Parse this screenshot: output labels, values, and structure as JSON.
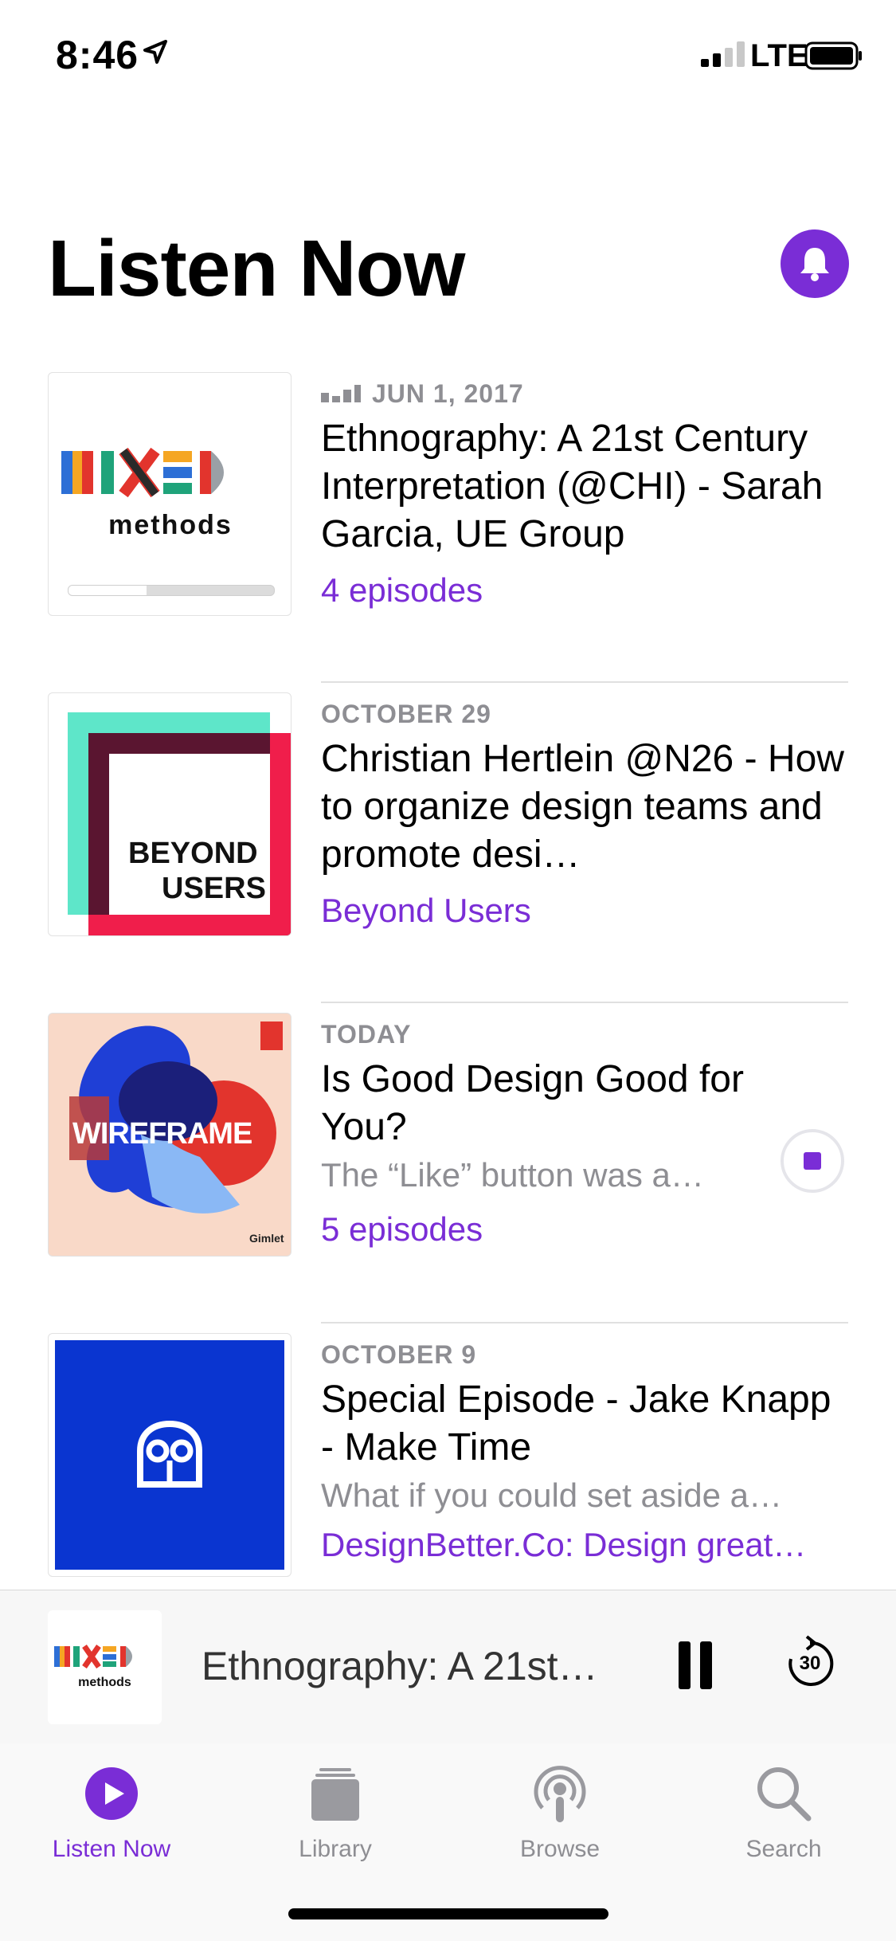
{
  "status_bar": {
    "time": "8:46",
    "network": "LTE"
  },
  "header": {
    "title": "Listen Now"
  },
  "episodes": [
    {
      "date": "JUN 1, 2017",
      "title": "Ethnography: A 21st Century Interpretation (@CHI) - Sarah Garcia, UE Group",
      "description": "",
      "show": "4 episodes",
      "art": "mixed-methods",
      "art_text": "methods",
      "played_fraction": 0.38
    },
    {
      "date": "OCTOBER 29",
      "title": "Christian Hertlein @N26 - How to organize design teams and promote desi…",
      "description": "",
      "show": "Beyond Users",
      "art": "beyond-users",
      "art_text": [
        "BEYOND",
        "USERS"
      ]
    },
    {
      "date": "TODAY",
      "title": "Is Good Design Good for You?",
      "description": "The “Like” button was a…",
      "show": "5 episodes",
      "art": "wireframe",
      "art_text": "WIREFRAME",
      "art_badge": "Gimlet"
    },
    {
      "date": "OCTOBER 9",
      "title": "Special Episode - Jake Knapp - Make Time",
      "description": "What if you could set aside a…",
      "show": "DesignBetter.Co: Design great…",
      "art": "designbetter"
    }
  ],
  "mini_player": {
    "title": "Ethnography: A 21st…",
    "skip_seconds": "30",
    "art_text": "methods"
  },
  "tabs": [
    {
      "label": "Listen Now",
      "icon": "play-circle-icon",
      "active": true
    },
    {
      "label": "Library",
      "icon": "library-icon",
      "active": false
    },
    {
      "label": "Browse",
      "icon": "podcast-icon",
      "active": false
    },
    {
      "label": "Search",
      "icon": "search-icon",
      "active": false
    }
  ],
  "colors": {
    "accent": "#7a2dd6",
    "secondary_text": "#8e8e93"
  }
}
